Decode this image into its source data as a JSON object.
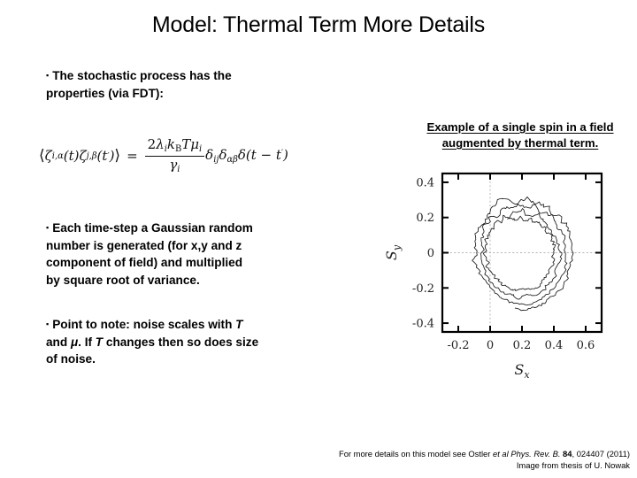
{
  "slide": {
    "title": "Model: Thermal Term More Details",
    "background_color": "#ffffff",
    "text_color": "#000000"
  },
  "bullets": [
    {
      "marker": "▪",
      "line1": "The stochastic process has the",
      "line2": "properties (via FDT):"
    },
    {
      "marker": "▪",
      "line1": "Each time-step a Gaussian random",
      "line2": "number is generated (for x,y and z",
      "line3": "component of field) and multiplied",
      "line4": "by square root of variance."
    },
    {
      "marker": "▪",
      "line_a": "Point to note: noise scales with ",
      "sym_T1": "T",
      "line_b": "and ",
      "sym_mu": "μ",
      "line_c": ". If ",
      "sym_T2": "T",
      "line_d": " changes then so does size",
      "line_e": "of noise."
    }
  ],
  "equation": {
    "lhs": "⟨ζ i,α (t) ζ j,β (t′)⟩",
    "equals": "=",
    "numerator": "2 λ i k B T μ i",
    "denominator": "γ i",
    "tail": "δ ij δ αβ δ(t − t′)",
    "plain_text": "⟨ζ_{i,α}(t) ζ_{j,β}(t')⟩ = (2 λ_i k_B T μ_i / γ_i) δ_{ij} δ_{αβ} δ(t − t')"
  },
  "figure": {
    "caption_line1": "Example of a single spin in a field",
    "caption_line2": "augmented by thermal term."
  },
  "chart_data": {
    "type": "line",
    "title": "",
    "xlabel": "Sx",
    "ylabel": "Sy",
    "xlim": [
      -0.3,
      0.7
    ],
    "ylim": [
      -0.45,
      0.45
    ],
    "xticks": [
      "-0.2",
      "0",
      "0.2",
      "0.4",
      "0.6"
    ],
    "xtick_values": [
      -0.2,
      0,
      0.2,
      0.4,
      0.6
    ],
    "yticks": [
      "0.4",
      "0.2",
      "0",
      "-0.2",
      "-0.4"
    ],
    "ytick_values": [
      0.4,
      0.2,
      0,
      -0.2,
      -0.4
    ],
    "grid": "dashed-zero-lines",
    "grid_lines": [
      {
        "axis": "x",
        "value": 0
      },
      {
        "axis": "y",
        "value": 0
      }
    ],
    "line_color": "#1a1a1a",
    "legend": "none",
    "description": "Noisy damped precession trajectory of a single spin; spirals inward from outer radius ~0.32 toward ~0.20, centred near (0.2, 0).",
    "series": [
      {
        "name": "spin-trajectory",
        "center": [
          0.2,
          0.0
        ],
        "radius_start": 0.325,
        "radius_end": 0.195,
        "turns": 3.6,
        "noise_amplitude": 0.012,
        "points_per_turn": 150
      }
    ]
  },
  "footer": {
    "line1_a": "For more details on this model see Ostler ",
    "line1_italic1": "et al",
    "line1_b": " ",
    "line1_italic2": "Phys. Rev. B.",
    "line1_c": " ",
    "line1_bold": "84",
    "line1_d": ", 024407 (2011)",
    "line2": "Image from thesis of U. Nowak"
  }
}
